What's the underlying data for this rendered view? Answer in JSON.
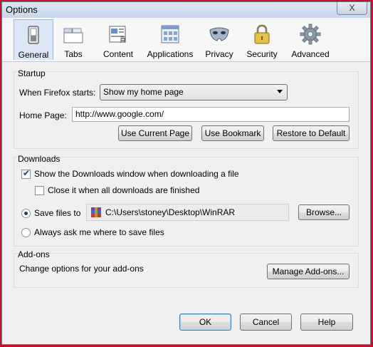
{
  "window": {
    "title": "Options",
    "close_label": "X"
  },
  "tabs": [
    {
      "label": "General",
      "icon": "switch-icon",
      "selected": true
    },
    {
      "label": "Tabs",
      "icon": "tabs-icon",
      "selected": false
    },
    {
      "label": "Content",
      "icon": "content-icon",
      "selected": false
    },
    {
      "label": "Applications",
      "icon": "applications-icon",
      "selected": false
    },
    {
      "label": "Privacy",
      "icon": "mask-icon",
      "selected": false
    },
    {
      "label": "Security",
      "icon": "lock-icon",
      "selected": false
    },
    {
      "label": "Advanced",
      "icon": "gear-icon",
      "selected": false
    }
  ],
  "startup": {
    "title": "Startup",
    "when_starts_label": "When Firefox starts:",
    "when_starts_value": "Show my home page",
    "home_page_label": "Home Page:",
    "home_page_value": "http://www.google.com/",
    "use_current_label": "Use Current Page",
    "use_bookmark_label": "Use Bookmark",
    "restore_label": "Restore to Default"
  },
  "downloads": {
    "title": "Downloads",
    "show_window_label": "Show the Downloads window when downloading a file",
    "show_window_checked": true,
    "close_it_label": "Close it when all downloads are finished",
    "close_it_checked": false,
    "save_files_label": "Save files to",
    "save_files_selected": true,
    "save_path": "C:\\Users\\stoney\\Desktop\\WinRAR",
    "browse_label": "Browse...",
    "always_ask_label": "Always ask me where to save files",
    "always_ask_selected": false
  },
  "addons": {
    "title": "Add-ons",
    "description": "Change options for your add-ons",
    "manage_label": "Manage Add-ons..."
  },
  "footer": {
    "ok_label": "OK",
    "cancel_label": "Cancel",
    "help_label": "Help"
  }
}
